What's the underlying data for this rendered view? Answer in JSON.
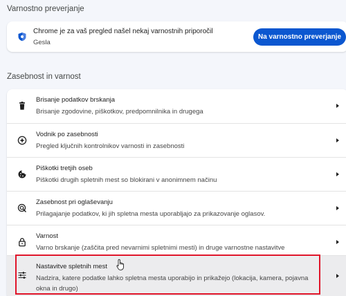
{
  "safety_check": {
    "section_title": "Varnostno preverjanje",
    "title": "Chrome je za vaš pregled našel nekaj varnostnih priporočil",
    "subtitle": "Gesla",
    "button_label": "Na varnostno preverjanje",
    "icon": "shield-icon"
  },
  "privacy": {
    "section_title": "Zasebnost in varnost",
    "items": [
      {
        "title": "Brisanje podatkov brskanja",
        "subtitle": "Brisanje zgodovine, piškotkov, predpomnilnika in drugega",
        "icon": "trash-icon"
      },
      {
        "title": "Vodnik po zasebnosti",
        "subtitle": "Pregled ključnih kontrolnikov varnosti in zasebnosti",
        "icon": "compass-icon"
      },
      {
        "title": "Piškotki tretjih oseb",
        "subtitle": "Piškotki drugih spletnih mest so blokirani v anonimnem načinu",
        "icon": "cookie-icon"
      },
      {
        "title": "Zasebnost pri oglaševanju",
        "subtitle": "Prilagajanje podatkov, ki jih spletna mesta uporabljajo za prikazovanje oglasov.",
        "icon": "ad-privacy-icon"
      },
      {
        "title": "Varnost",
        "subtitle": "Varno brskanje (zaščita pred nevarnimi spletnimi mesti) in druge varnostne nastavitve",
        "icon": "lock-icon"
      },
      {
        "title": "Nastavitve spletnih mest",
        "subtitle": "Nadzira, katere podatke lahko spletna mesta uporabijo in prikažejo (lokacija, kamera, pojavna okna in drugo)",
        "icon": "sliders-icon"
      }
    ]
  },
  "colors": {
    "accent": "#0b57d0",
    "highlight_border": "#e0152a",
    "background": "#f4f6fb"
  }
}
